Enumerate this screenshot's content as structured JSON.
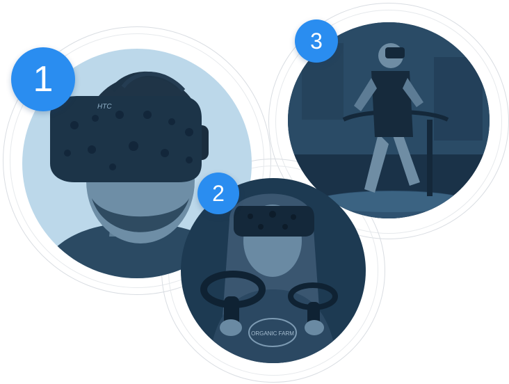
{
  "colors": {
    "badge": "#2a8df0",
    "photo_1_bg": "#bcd8ea",
    "photo_dark_bg": "#1d3a52",
    "ring": "#d9dde2"
  },
  "steps": [
    {
      "number": "1",
      "subject": "man-wearing-htc-vive-headset",
      "headset_brand": "HTC"
    },
    {
      "number": "2",
      "subject": "woman-wearing-vr-headset-holding-controllers",
      "shirt_text": "ORGANIC FARM"
    },
    {
      "number": "3",
      "subject": "man-walking-on-vr-treadmill"
    }
  ]
}
